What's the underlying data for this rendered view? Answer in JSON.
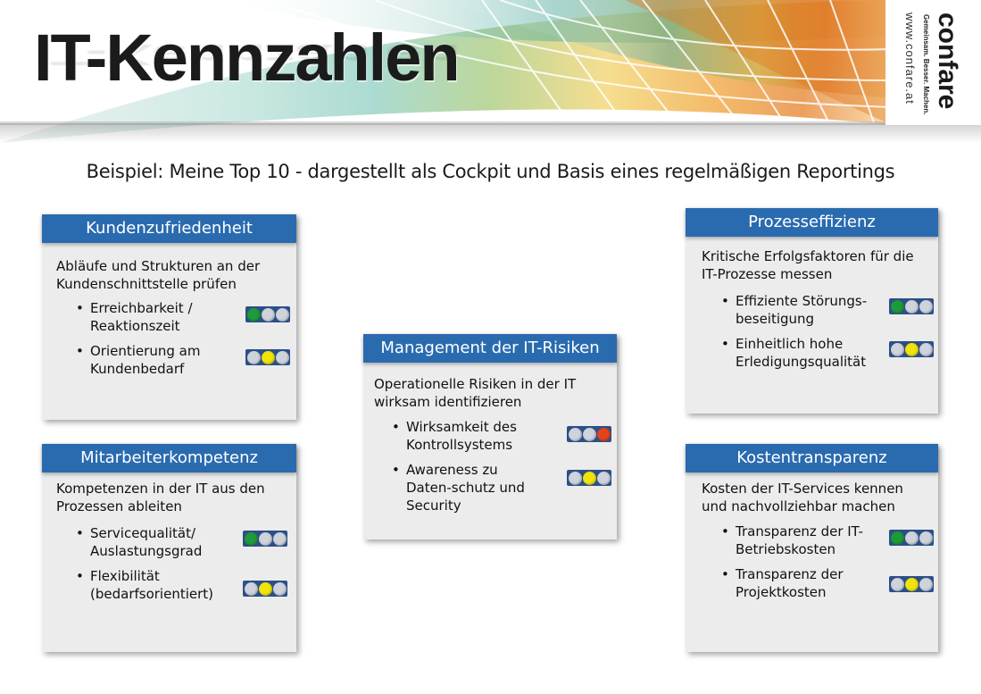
{
  "header": {
    "title": "IT-Kennzahlen",
    "logo": {
      "word": "confare",
      "tagline": "Gemeinsam. Besser. Machen.",
      "url": "www.confare.at"
    }
  },
  "subtitle": "Beispiel: Meine Top 10 - dargestellt als Cockpit und Basis eines regelmäßigen Reportings",
  "colors": {
    "header_bar": "#2a6bb0",
    "card_bg": "#ececec",
    "status_green": "#1f9a3a",
    "status_yellow": "#f2e40a",
    "status_red": "#e4441c",
    "status_off": "#cfd4dc"
  },
  "cards": [
    {
      "title": "Kundenzufriedenheit",
      "description": "Abläufe und Strukturen an der Kundenschnittstelle prüfen",
      "kpis": [
        {
          "label": "Erreichbarkeit / Reaktionszeit",
          "status": "green"
        },
        {
          "label": "Orientierung am Kundenbedarf",
          "status": "yellow"
        }
      ]
    },
    {
      "title": "Mitarbeiterkompetenz",
      "description": "Kompetenzen in der IT aus den Prozessen ableiten",
      "kpis": [
        {
          "label": "Servicequalität/ Auslastungsgrad",
          "status": "green"
        },
        {
          "label": "Flexibilität (bedarfsorientiert)",
          "status": "yellow"
        }
      ]
    },
    {
      "title": "Management der IT-Risiken",
      "description": "Operationelle Risiken in der IT wirksam identifizieren",
      "kpis": [
        {
          "label": "Wirksamkeit des Kontrollsystems",
          "status": "red"
        },
        {
          "label": "Awareness zu Daten-schutz und Security",
          "status": "yellow"
        }
      ]
    },
    {
      "title": "Prozesseffizienz",
      "description": "Kritische Erfolgsfaktoren für die IT-Prozesse messen",
      "kpis": [
        {
          "label": "Effiziente Störungs-beseitigung",
          "status": "green"
        },
        {
          "label": "Einheitlich hohe Erledigungsqualität",
          "status": "yellow"
        }
      ]
    },
    {
      "title": "Kostentransparenz",
      "description": "Kosten der IT-Services kennen und nachvollziehbar machen",
      "kpis": [
        {
          "label": "Transparenz der IT-Betriebskosten",
          "status": "green"
        },
        {
          "label": "Transparenz der Projektkosten",
          "status": "yellow"
        }
      ]
    }
  ]
}
